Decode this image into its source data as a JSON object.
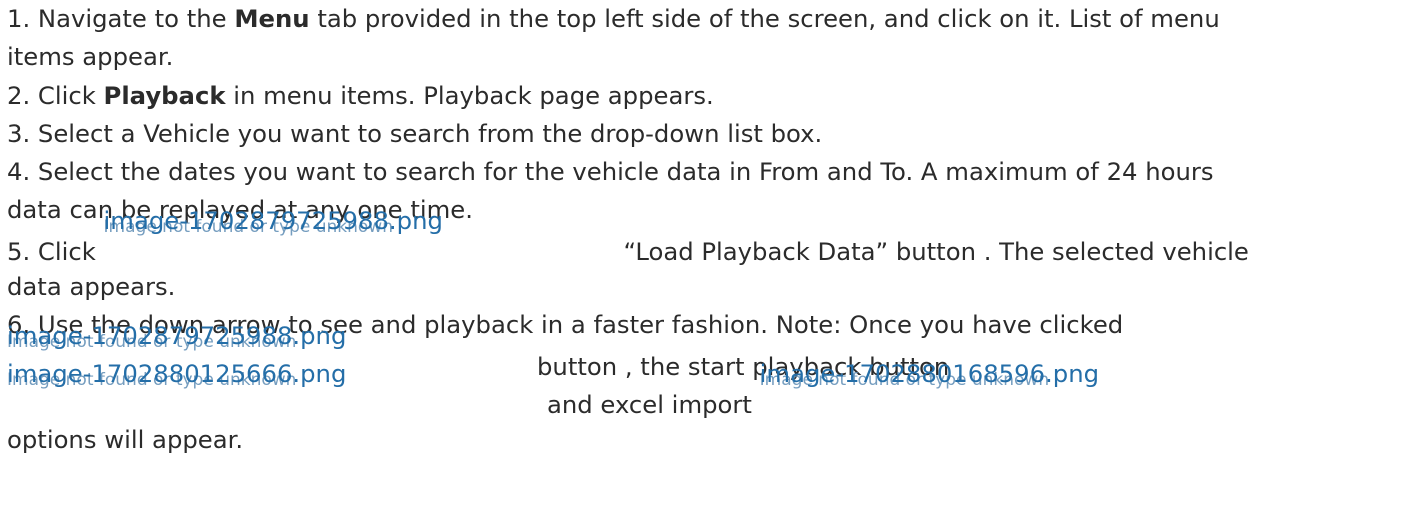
{
  "steps": [
    {
      "line1": {
        "pre": "1. Navigate to the ",
        "bold": "Menu",
        "post": " tab provided in the top left side of the screen, and click on it. List of menu"
      },
      "line2": "items appear."
    },
    {
      "pre": "2. Click ",
      "bold": "Playback",
      "post": " in menu items. Playback page appears."
    },
    {
      "text": "3. Select a Vehicle you want to search from the drop-down list box."
    },
    {
      "line1": "4. Select the dates you want to search for the vehicle data in From and To. A maximum of 24 hours",
      "line2": "data can be replayed at any one time."
    },
    {
      "pre": "5. Click ",
      "post": "“Load Playback Data” button . The selected vehicle",
      "line2": "data appears."
    },
    {
      "line1": "6. Use the down arrow to see and playback in a faster fashion. Note: Once you have clicked",
      "after_img1": "button , the start playback button",
      "after_img2": "and excel import",
      "line_end": "options will appear."
    }
  ],
  "images": {
    "img_a": {
      "filename": "image-17028797259​88.png",
      "alt": "Image not found or type unknown"
    },
    "img_b": {
      "filename": "image-1702880125666.png",
      "alt": "Image not found or type unknown"
    },
    "img_c": {
      "filename": "image-1702880168596.png",
      "alt": "Image not found or type unknown"
    }
  },
  "colors": {
    "text": "#2b2b2b",
    "link": "#246ea8"
  }
}
